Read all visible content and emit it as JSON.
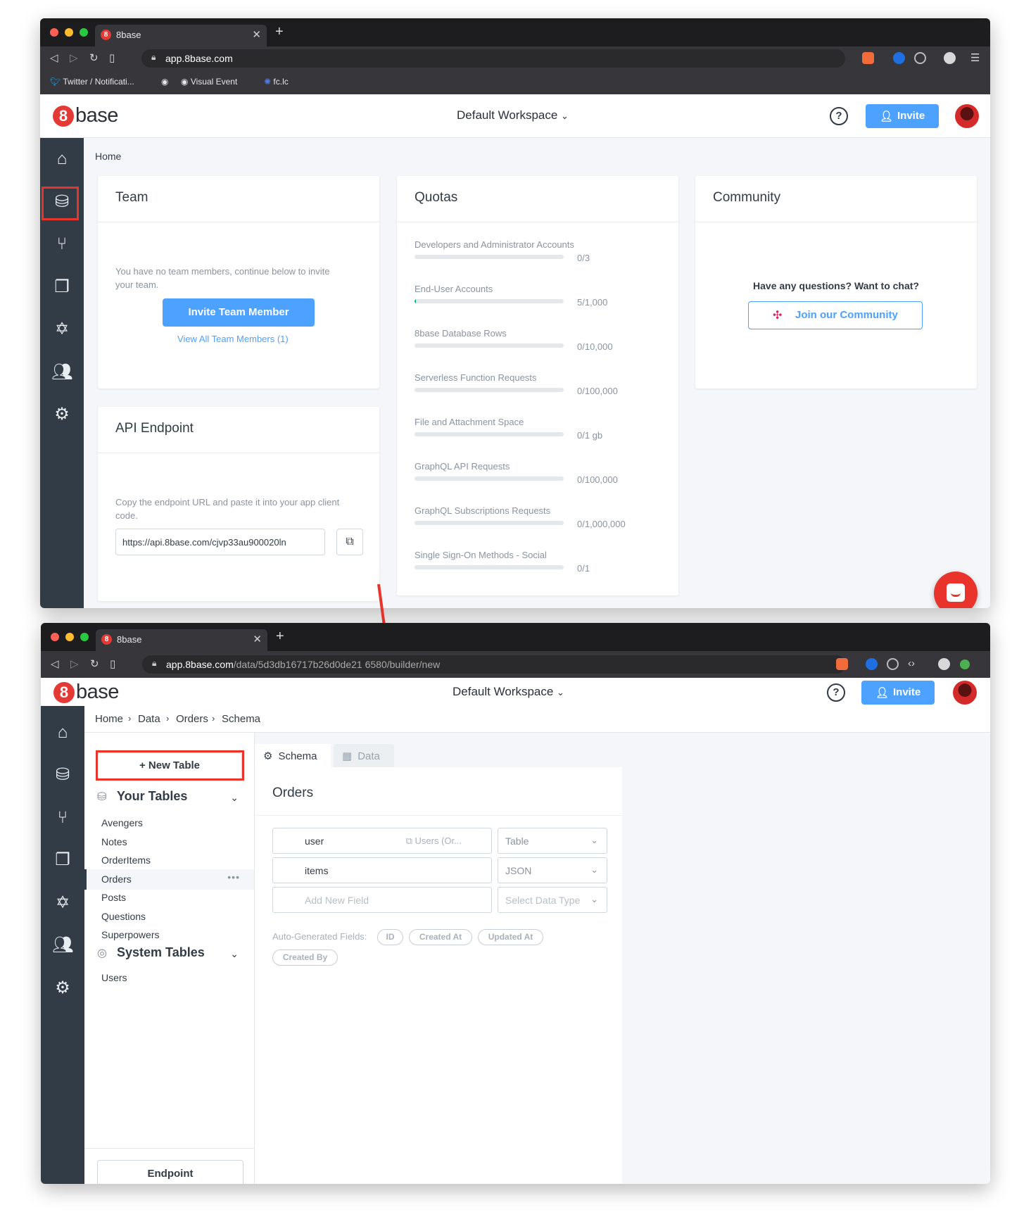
{
  "window1": {
    "browser": {
      "tab_title": "8base",
      "tab_favicon": "8",
      "url": "app.8base.com",
      "bookmarks": [
        "Twitter / Notificati...",
        "Visual Event",
        "fc.lc"
      ]
    },
    "header": {
      "logo_mark": "8",
      "logo_text": "base",
      "workspace": "Default Workspace",
      "help": "?",
      "invite_label": "Invite"
    },
    "breadcrumb": "Home",
    "team": {
      "title": "Team",
      "message": "You have no team members, continue below to invite your team.",
      "invite_button": "Invite Team Member",
      "view_all_link": "View All Team Members (1)"
    },
    "api_endpoint": {
      "title": "API Endpoint",
      "message": "Copy the endpoint URL and paste it into your app client code.",
      "url_value": "https://api.8base.com/cjvp33au900020ln"
    },
    "quotas": {
      "title": "Quotas",
      "items": [
        {
          "label": "Developers and Administrator Accounts",
          "value": "0/3",
          "fraction": 0
        },
        {
          "label": "End-User Accounts",
          "value": "5/1,000",
          "fraction": 0.005
        },
        {
          "label": "8base Database Rows",
          "value": "0/10,000",
          "fraction": 0
        },
        {
          "label": "Serverless Function Requests",
          "value": "0/100,000",
          "fraction": 0
        },
        {
          "label": "File and Attachment Space",
          "value": "0/1 gb",
          "fraction": 0
        },
        {
          "label": "GraphQL API Requests",
          "value": "0/100,000",
          "fraction": 0
        },
        {
          "label": "GraphQL Subscriptions Requests",
          "value": "0/1,000,000",
          "fraction": 0
        },
        {
          "label": "Single Sign-On Methods - Social",
          "value": "0/1",
          "fraction": 0
        }
      ]
    },
    "community": {
      "title": "Community",
      "question": "Have any questions? Want to chat?",
      "button": "Join our Community"
    }
  },
  "window2": {
    "browser": {
      "tab_title": "8base",
      "tab_favicon": "8",
      "url_host": "app.8base.com",
      "url_path": "/data/5d3db16717b26d0de21 6580/builder/new"
    },
    "header": {
      "logo_mark": "8",
      "logo_text": "base",
      "workspace": "Default Workspace",
      "help": "?",
      "invite_label": "Invite"
    },
    "breadcrumb": [
      "Home",
      "Data",
      "Orders",
      "Schema"
    ],
    "new_table_button": "+ New Table",
    "your_tables": {
      "title": "Your Tables",
      "items": [
        "Avengers",
        "Notes",
        "OrderItems",
        "Orders",
        "Posts",
        "Questions",
        "Superpowers"
      ],
      "active": "Orders",
      "more": "•••"
    },
    "system_tables": {
      "title": "System Tables",
      "items": [
        "Users"
      ]
    },
    "endpoint_button": "Endpoint",
    "tabs": {
      "schema": "Schema",
      "data": "Data"
    },
    "schema": {
      "table_name": "Orders",
      "fields": [
        {
          "name": "user",
          "relation": "Users (Or...",
          "type": "Table"
        },
        {
          "name": "items",
          "relation": "",
          "type": "JSON"
        }
      ],
      "new_field_placeholder": "Add New Field",
      "new_type_placeholder": "Select Data Type",
      "auto_label": "Auto-Generated Fields:",
      "auto_fields": [
        "ID",
        "Created At",
        "Updated At",
        "Created By"
      ]
    }
  },
  "colors": {
    "accent": "#4da1ff",
    "brand_red": "#e53935",
    "sidebar": "#323c47",
    "highlight_red": "#e8342a",
    "progress": "#00bb6e"
  }
}
